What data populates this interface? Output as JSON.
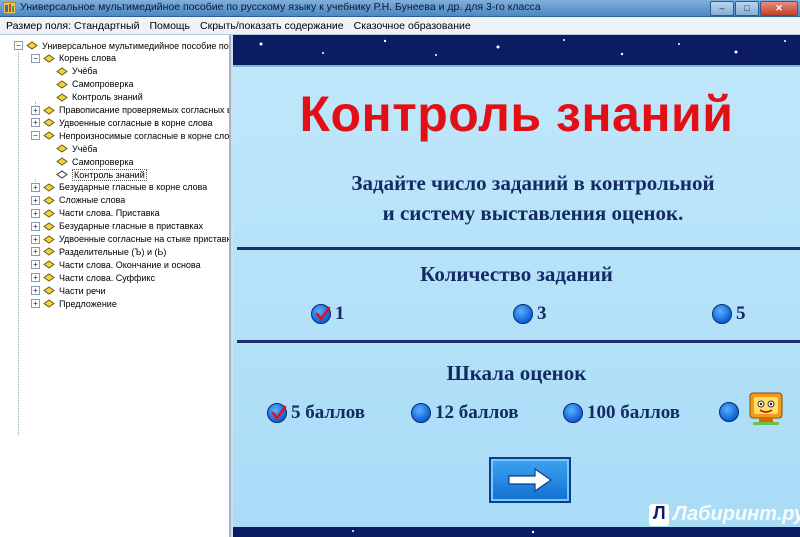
{
  "window": {
    "title": "Универсальное мультимедийное пособие по русскому языку к учебнику Р.Н. Бунеева и др. для 3-го класса",
    "buttons": {
      "minimize": "–",
      "maximize": "□",
      "close": "✕"
    }
  },
  "menu": [
    "Размер поля: Стандартный",
    "Помощь",
    "Скрыть/показать содержание",
    "Сказочное образование"
  ],
  "tree": [
    {
      "label": "Универсальное мультимедийное пособие по",
      "level": 0,
      "expander": "−"
    },
    {
      "label": "Корень слова",
      "level": 1,
      "expander": "−"
    },
    {
      "label": "Учёба",
      "level": 2,
      "expander": ""
    },
    {
      "label": "Самопроверка",
      "level": 2,
      "expander": ""
    },
    {
      "label": "Контроль знаний",
      "level": 2,
      "expander": ""
    },
    {
      "label": "Правописание проверяемых согласных в",
      "level": 1,
      "expander": "+"
    },
    {
      "label": "Удвоенные согласные в корне слова",
      "level": 1,
      "expander": "+"
    },
    {
      "label": "Непроизносимые согласные в корне сло",
      "level": 1,
      "expander": "−"
    },
    {
      "label": "Учёба",
      "level": 2,
      "expander": ""
    },
    {
      "label": "Самопроверка",
      "level": 2,
      "expander": ""
    },
    {
      "label": "Контроль знаний",
      "level": 2,
      "expander": "",
      "selected": true
    },
    {
      "label": "Безударные гласные в корне слова",
      "level": 1,
      "expander": "+"
    },
    {
      "label": "Сложные слова",
      "level": 1,
      "expander": "+"
    },
    {
      "label": "Части слова. Приставка",
      "level": 1,
      "expander": "+"
    },
    {
      "label": "Безударные гласные в приставках",
      "level": 1,
      "expander": "+"
    },
    {
      "label": "Удвоенные согласные на стыке приставк",
      "level": 1,
      "expander": "+"
    },
    {
      "label": "Разделительные (Ъ) и (Ь)",
      "level": 1,
      "expander": "+"
    },
    {
      "label": "Части слова. Окончание и основа",
      "level": 1,
      "expander": "+"
    },
    {
      "label": "Части слова. Суффикс",
      "level": 1,
      "expander": "+"
    },
    {
      "label": "Части речи",
      "level": 1,
      "expander": "+"
    },
    {
      "label": "Предложение",
      "level": 1,
      "expander": "+"
    }
  ],
  "content": {
    "heading": "Контроль знаний",
    "subtitle_line1": "Задайте число заданий в контрольной",
    "subtitle_line2": "и систему выставления оценок.",
    "tasks_title": "Количество заданий",
    "tasks_options": [
      {
        "label": "1",
        "selected": true
      },
      {
        "label": "3",
        "selected": false
      },
      {
        "label": "5",
        "selected": false
      }
    ],
    "scale_title": "Шкала оценок",
    "scale_options": [
      {
        "label": "5 баллов",
        "selected": true
      },
      {
        "label": "12 баллов",
        "selected": false
      },
      {
        "label": "100 баллов",
        "selected": false
      },
      {
        "label": "",
        "selected": false
      }
    ],
    "next_icon": "right-arrow-icon",
    "watermark": "Лабиринт.ру"
  },
  "colors": {
    "heading": "#e30f16",
    "text": "#132a63",
    "panel": "#bfe7fb",
    "background": "#0c1c62",
    "radio": "#0d60d8"
  }
}
